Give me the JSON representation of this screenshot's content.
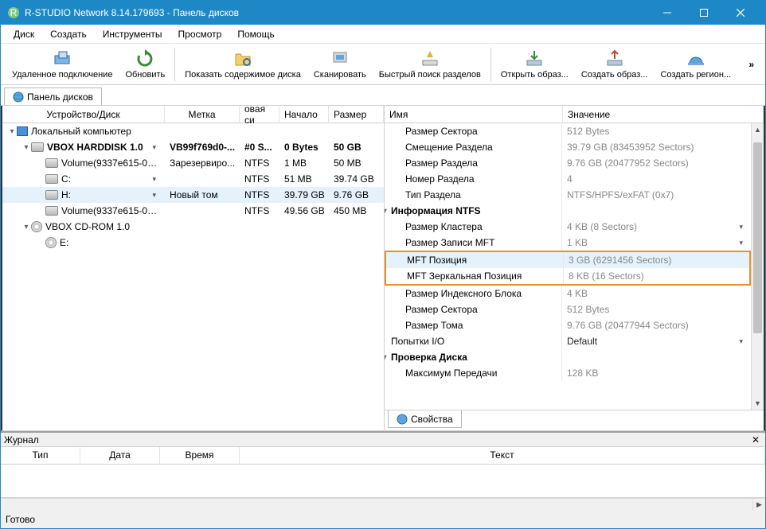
{
  "title": "R-STUDIO Network 8.14.179693 - Панель дисков",
  "menu": [
    "Диск",
    "Создать",
    "Инструменты",
    "Просмотр",
    "Помощь"
  ],
  "toolbar": [
    {
      "id": "remote",
      "label": "Удаленное подключение"
    },
    {
      "id": "refresh",
      "label": "Обновить"
    },
    {
      "id": "show",
      "label": "Показать содержимое диска"
    },
    {
      "id": "scan",
      "label": "Сканировать"
    },
    {
      "id": "quick",
      "label": "Быстрый поиск разделов"
    },
    {
      "id": "openimg",
      "label": "Открыть образ..."
    },
    {
      "id": "createimg",
      "label": "Создать образ..."
    },
    {
      "id": "createreg",
      "label": "Создать регион..."
    }
  ],
  "overflow": "»",
  "tab_drives": "Панель дисков",
  "left_head": [
    "Устройство/Диск",
    "Метка",
    "овая си",
    "Начало",
    "Размер"
  ],
  "devices": [
    {
      "indent": 0,
      "toggle": "▾",
      "icon": "pc",
      "name": "Локальный компьютер",
      "label": "",
      "fs": "",
      "start": "",
      "size": ""
    },
    {
      "indent": 1,
      "toggle": "▾",
      "icon": "hd",
      "name": "VBOX HARDDISK 1.0",
      "label": "VB99f769d0-...",
      "fs": "#0 S...",
      "start": "0 Bytes",
      "size": "50 GB",
      "bold": true,
      "dd": true
    },
    {
      "indent": 2,
      "toggle": "",
      "icon": "hd",
      "name": "Volume(9337e615-00...",
      "label": "Зарезервиро...",
      "fs": "NTFS",
      "start": "1 MB",
      "size": "50 MB"
    },
    {
      "indent": 2,
      "toggle": "",
      "icon": "hd",
      "name": "C:",
      "label": "",
      "fs": "NTFS",
      "start": "51 MB",
      "size": "39.74 GB",
      "dd": true
    },
    {
      "indent": 2,
      "toggle": "",
      "icon": "hd",
      "name": "H:",
      "label": "Новый том",
      "fs": "NTFS",
      "start": "39.79 GB",
      "size": "9.76 GB",
      "dd": true,
      "sel": true
    },
    {
      "indent": 2,
      "toggle": "",
      "icon": "hd",
      "name": "Volume(9337e615-00...",
      "label": "",
      "fs": "NTFS",
      "start": "49.56 GB",
      "size": "450 MB"
    },
    {
      "indent": 1,
      "toggle": "▾",
      "icon": "cd",
      "name": "VBOX CD-ROM 1.0",
      "label": "",
      "fs": "",
      "start": "",
      "size": ""
    },
    {
      "indent": 2,
      "toggle": "",
      "icon": "cd",
      "name": "E:",
      "label": "",
      "fs": "",
      "start": "",
      "size": ""
    }
  ],
  "right_head": [
    "Имя",
    "Значение"
  ],
  "props": [
    {
      "i": 1,
      "n": "Размер Сектора",
      "v": "512 Bytes"
    },
    {
      "i": 1,
      "n": "Смещение Раздела",
      "v": "39.79 GB (83453952 Sectors)"
    },
    {
      "i": 1,
      "n": "Размер Раздела",
      "v": "9.76 GB (20477952 Sectors)"
    },
    {
      "i": 1,
      "n": "Номер Раздела",
      "v": "4"
    },
    {
      "i": 1,
      "n": "Тип Раздела",
      "v": "NTFS/HPFS/exFAT (0x7)"
    },
    {
      "i": 0,
      "t": "▾",
      "n": "Информация NTFS",
      "v": "",
      "bold": true
    },
    {
      "i": 1,
      "n": "Размер Кластера",
      "v": "4 KB (8 Sectors)",
      "dd": true
    },
    {
      "i": 1,
      "n": "Размер Записи MFT",
      "v": "1 KB",
      "dd": true
    },
    {
      "i": 1,
      "n": "MFT Позиция",
      "v": "3 GB (6291456 Sectors)",
      "hl": true,
      "box": "start"
    },
    {
      "i": 1,
      "n": "MFT Зеркальная Позиция",
      "v": "8 KB (16 Sectors)",
      "box": "end"
    },
    {
      "i": 1,
      "n": "Размер Индексного Блока",
      "v": "4 KB"
    },
    {
      "i": 1,
      "n": "Размер Сектора",
      "v": "512 Bytes"
    },
    {
      "i": 1,
      "n": "Размер Тома",
      "v": "9.76 GB (20477944 Sectors)"
    },
    {
      "i": 0,
      "n": "Попытки I/O",
      "v": "Default",
      "dd": true,
      "dv": true
    },
    {
      "i": 0,
      "t": "▾",
      "n": "Проверка Диска",
      "v": "",
      "bold": true
    },
    {
      "i": 1,
      "n": "Максимум Передачи",
      "v": "128 KB"
    }
  ],
  "tab_props": "Свойства",
  "journal": {
    "title": "Журнал",
    "cols": [
      "Тип",
      "Дата",
      "Время",
      "Текст"
    ]
  },
  "status": "Готово"
}
